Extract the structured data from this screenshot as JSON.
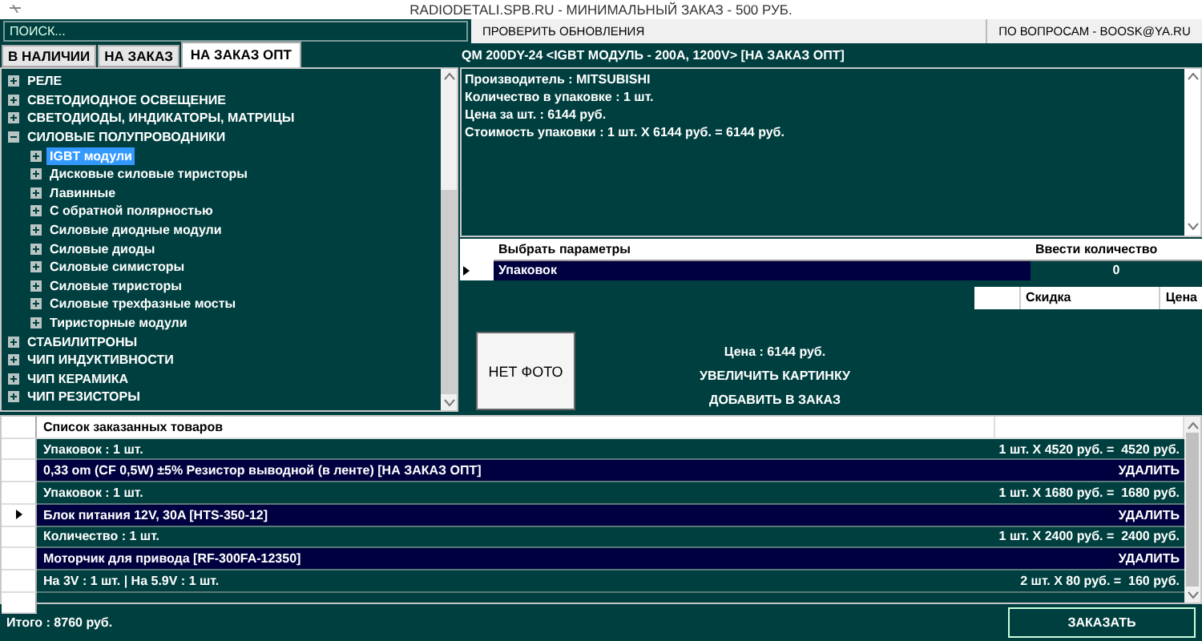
{
  "window": {
    "title": "RADIODETALI.SPB.RU - МИНИМАЛЬНЫЙ ЗАКАЗ - 500 РУБ."
  },
  "search": {
    "placeholder": "ПОИСК..."
  },
  "top_buttons": [
    "ПРОВЕРИТЬ ОБНОВЛЕНИЯ",
    "ПО ВОПРОСАМ - BOOSK@YA.RU"
  ],
  "tabs": [
    {
      "label": "В НАЛИЧИИ",
      "selected": false
    },
    {
      "label": "НА ЗАКАЗ",
      "selected": false
    },
    {
      "label": "НА ЗАКАЗ ОПТ",
      "selected": true
    }
  ],
  "tree": [
    {
      "label": "РЕЛЕ",
      "expanded": false,
      "selected": false
    },
    {
      "label": "СВЕТОДИОДНОЕ ОСВЕЩЕНИЕ",
      "expanded": false,
      "selected": false
    },
    {
      "label": "СВЕТОДИОДЫ, ИНДИКАТОРЫ, МАТРИЦЫ",
      "expanded": false,
      "selected": false
    },
    {
      "label": "СИЛОВЫЕ ПОЛУПРОВОДНИКИ",
      "expanded": true,
      "selected": false,
      "children": [
        {
          "label": "IGBT модули",
          "expanded": false,
          "selected": true
        },
        {
          "label": "Дисковые силовые тиристоры",
          "expanded": false,
          "selected": false
        },
        {
          "label": "Лавинные",
          "expanded": false,
          "selected": false
        },
        {
          "label": "С обратной полярностью",
          "expanded": false,
          "selected": false
        },
        {
          "label": "Силовые диодные модули",
          "expanded": false,
          "selected": false
        },
        {
          "label": "Силовые диоды",
          "expanded": false,
          "selected": false
        },
        {
          "label": "Силовые симисторы",
          "expanded": false,
          "selected": false
        },
        {
          "label": "Силовые тиристоры",
          "expanded": false,
          "selected": false
        },
        {
          "label": "Силовые трехфазные мосты",
          "expanded": false,
          "selected": false
        },
        {
          "label": "Тиристорные модули",
          "expanded": false,
          "selected": false
        }
      ]
    },
    {
      "label": "СТАБИЛИТРОНЫ",
      "expanded": false,
      "selected": false
    },
    {
      "label": "ЧИП ИНДУКТИВНОСТИ",
      "expanded": false,
      "selected": false
    },
    {
      "label": "ЧИП КЕРАМИКА",
      "expanded": false,
      "selected": false
    },
    {
      "label": "ЧИП РЕЗИСТОРЫ",
      "expanded": false,
      "selected": false
    }
  ],
  "product": {
    "title": "QM 200DY-24 <IGBT МОДУЛЬ - 200A, 1200V> [НА ЗАКАЗ ОПТ]",
    "details": [
      "Производитель : MITSUBISHI",
      "Количество в упаковке : 1 шт.",
      "Цена за шт. : 6144 руб.",
      "Стоимость упаковки : 1 шт. X 6144 руб. = 6144 руб."
    ]
  },
  "params_grid": {
    "columns": [
      "Выбрать параметры",
      "Ввести количество"
    ],
    "rows": [
      {
        "param": "Упаковок",
        "quantity": "0",
        "selected": true
      }
    ]
  },
  "photo": {
    "label": "НЕТ ФОТО"
  },
  "price": "Цена : 6144 руб.",
  "actions": [
    "УВЕЛИЧИТЬ КАРТИНКУ",
    "ДОБАВИТЬ В ЗАКАЗ"
  ],
  "discount_table": {
    "columns": [
      "Скидка",
      "Цена"
    ]
  },
  "order_list": {
    "title": "Список заказанных товаров",
    "rows": [
      {
        "kind": "detail",
        "text": "Упаковок : 1 шт.",
        "right": "1 шт. X 4520 руб. =  4520 руб.",
        "current": false
      },
      {
        "kind": "item",
        "text": "0,33 om (CF 0,5W) ±5% Резистор выводной (в ленте) [НА ЗАКАЗ ОПТ]",
        "right": "УДАЛИТЬ",
        "current": false
      },
      {
        "kind": "detail",
        "text": "Упаковок : 1 шт.",
        "right": "1 шт. X 1680 руб. =  1680 руб.",
        "current": false
      },
      {
        "kind": "item",
        "text": "Блок питания 12V, 30A [HTS-350-12]",
        "right": "УДАЛИТЬ",
        "current": true
      },
      {
        "kind": "detail",
        "text": "Количество : 1 шт.",
        "right": "1 шт. X 2400 руб. =  2400 руб.",
        "current": false
      },
      {
        "kind": "item",
        "text": "Моторчик для привода [RF-300FA-12350]",
        "right": "УДАЛИТЬ",
        "current": false
      },
      {
        "kind": "detail",
        "text": "На 3V : 1 шт. | На 5.9V : 1 шт.",
        "right": "2 шт. X 80 руб. =  160 руб.",
        "current": false
      }
    ]
  },
  "footer": {
    "total": "Итого : 8760 руб.",
    "button": "ЗАКАЗАТЬ"
  }
}
